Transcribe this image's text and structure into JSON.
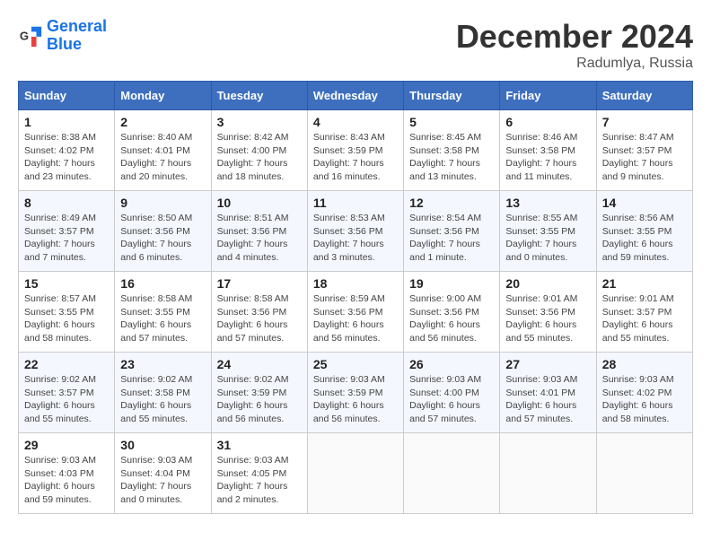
{
  "header": {
    "logo_line1": "General",
    "logo_line2": "Blue",
    "month": "December 2024",
    "location": "Radumlya, Russia"
  },
  "days_of_week": [
    "Sunday",
    "Monday",
    "Tuesday",
    "Wednesday",
    "Thursday",
    "Friday",
    "Saturday"
  ],
  "weeks": [
    [
      {
        "day": "1",
        "sunrise": "Sunrise: 8:38 AM",
        "sunset": "Sunset: 4:02 PM",
        "daylight": "Daylight: 7 hours and 23 minutes."
      },
      {
        "day": "2",
        "sunrise": "Sunrise: 8:40 AM",
        "sunset": "Sunset: 4:01 PM",
        "daylight": "Daylight: 7 hours and 20 minutes."
      },
      {
        "day": "3",
        "sunrise": "Sunrise: 8:42 AM",
        "sunset": "Sunset: 4:00 PM",
        "daylight": "Daylight: 7 hours and 18 minutes."
      },
      {
        "day": "4",
        "sunrise": "Sunrise: 8:43 AM",
        "sunset": "Sunset: 3:59 PM",
        "daylight": "Daylight: 7 hours and 16 minutes."
      },
      {
        "day": "5",
        "sunrise": "Sunrise: 8:45 AM",
        "sunset": "Sunset: 3:58 PM",
        "daylight": "Daylight: 7 hours and 13 minutes."
      },
      {
        "day": "6",
        "sunrise": "Sunrise: 8:46 AM",
        "sunset": "Sunset: 3:58 PM",
        "daylight": "Daylight: 7 hours and 11 minutes."
      },
      {
        "day": "7",
        "sunrise": "Sunrise: 8:47 AM",
        "sunset": "Sunset: 3:57 PM",
        "daylight": "Daylight: 7 hours and 9 minutes."
      }
    ],
    [
      {
        "day": "8",
        "sunrise": "Sunrise: 8:49 AM",
        "sunset": "Sunset: 3:57 PM",
        "daylight": "Daylight: 7 hours and 7 minutes."
      },
      {
        "day": "9",
        "sunrise": "Sunrise: 8:50 AM",
        "sunset": "Sunset: 3:56 PM",
        "daylight": "Daylight: 7 hours and 6 minutes."
      },
      {
        "day": "10",
        "sunrise": "Sunrise: 8:51 AM",
        "sunset": "Sunset: 3:56 PM",
        "daylight": "Daylight: 7 hours and 4 minutes."
      },
      {
        "day": "11",
        "sunrise": "Sunrise: 8:53 AM",
        "sunset": "Sunset: 3:56 PM",
        "daylight": "Daylight: 7 hours and 3 minutes."
      },
      {
        "day": "12",
        "sunrise": "Sunrise: 8:54 AM",
        "sunset": "Sunset: 3:56 PM",
        "daylight": "Daylight: 7 hours and 1 minute."
      },
      {
        "day": "13",
        "sunrise": "Sunrise: 8:55 AM",
        "sunset": "Sunset: 3:55 PM",
        "daylight": "Daylight: 7 hours and 0 minutes."
      },
      {
        "day": "14",
        "sunrise": "Sunrise: 8:56 AM",
        "sunset": "Sunset: 3:55 PM",
        "daylight": "Daylight: 6 hours and 59 minutes."
      }
    ],
    [
      {
        "day": "15",
        "sunrise": "Sunrise: 8:57 AM",
        "sunset": "Sunset: 3:55 PM",
        "daylight": "Daylight: 6 hours and 58 minutes."
      },
      {
        "day": "16",
        "sunrise": "Sunrise: 8:58 AM",
        "sunset": "Sunset: 3:55 PM",
        "daylight": "Daylight: 6 hours and 57 minutes."
      },
      {
        "day": "17",
        "sunrise": "Sunrise: 8:58 AM",
        "sunset": "Sunset: 3:56 PM",
        "daylight": "Daylight: 6 hours and 57 minutes."
      },
      {
        "day": "18",
        "sunrise": "Sunrise: 8:59 AM",
        "sunset": "Sunset: 3:56 PM",
        "daylight": "Daylight: 6 hours and 56 minutes."
      },
      {
        "day": "19",
        "sunrise": "Sunrise: 9:00 AM",
        "sunset": "Sunset: 3:56 PM",
        "daylight": "Daylight: 6 hours and 56 minutes."
      },
      {
        "day": "20",
        "sunrise": "Sunrise: 9:01 AM",
        "sunset": "Sunset: 3:56 PM",
        "daylight": "Daylight: 6 hours and 55 minutes."
      },
      {
        "day": "21",
        "sunrise": "Sunrise: 9:01 AM",
        "sunset": "Sunset: 3:57 PM",
        "daylight": "Daylight: 6 hours and 55 minutes."
      }
    ],
    [
      {
        "day": "22",
        "sunrise": "Sunrise: 9:02 AM",
        "sunset": "Sunset: 3:57 PM",
        "daylight": "Daylight: 6 hours and 55 minutes."
      },
      {
        "day": "23",
        "sunrise": "Sunrise: 9:02 AM",
        "sunset": "Sunset: 3:58 PM",
        "daylight": "Daylight: 6 hours and 55 minutes."
      },
      {
        "day": "24",
        "sunrise": "Sunrise: 9:02 AM",
        "sunset": "Sunset: 3:59 PM",
        "daylight": "Daylight: 6 hours and 56 minutes."
      },
      {
        "day": "25",
        "sunrise": "Sunrise: 9:03 AM",
        "sunset": "Sunset: 3:59 PM",
        "daylight": "Daylight: 6 hours and 56 minutes."
      },
      {
        "day": "26",
        "sunrise": "Sunrise: 9:03 AM",
        "sunset": "Sunset: 4:00 PM",
        "daylight": "Daylight: 6 hours and 57 minutes."
      },
      {
        "day": "27",
        "sunrise": "Sunrise: 9:03 AM",
        "sunset": "Sunset: 4:01 PM",
        "daylight": "Daylight: 6 hours and 57 minutes."
      },
      {
        "day": "28",
        "sunrise": "Sunrise: 9:03 AM",
        "sunset": "Sunset: 4:02 PM",
        "daylight": "Daylight: 6 hours and 58 minutes."
      }
    ],
    [
      {
        "day": "29",
        "sunrise": "Sunrise: 9:03 AM",
        "sunset": "Sunset: 4:03 PM",
        "daylight": "Daylight: 6 hours and 59 minutes."
      },
      {
        "day": "30",
        "sunrise": "Sunrise: 9:03 AM",
        "sunset": "Sunset: 4:04 PM",
        "daylight": "Daylight: 7 hours and 0 minutes."
      },
      {
        "day": "31",
        "sunrise": "Sunrise: 9:03 AM",
        "sunset": "Sunset: 4:05 PM",
        "daylight": "Daylight: 7 hours and 2 minutes."
      },
      null,
      null,
      null,
      null
    ]
  ]
}
